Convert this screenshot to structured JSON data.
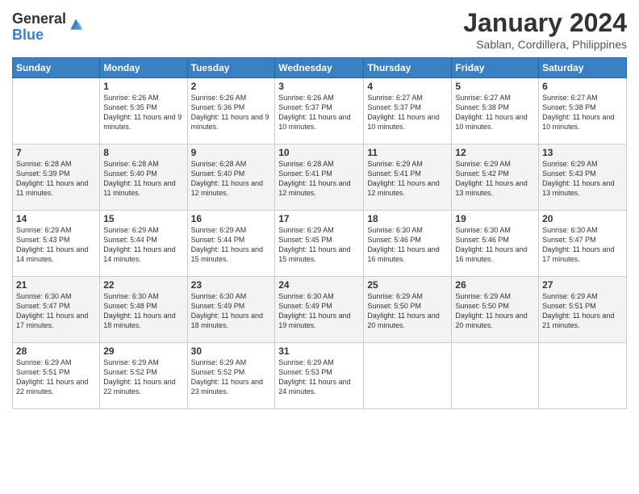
{
  "logo": {
    "general": "General",
    "blue": "Blue"
  },
  "title": "January 2024",
  "subtitle": "Sablan, Cordillera, Philippines",
  "weekdays": [
    "Sunday",
    "Monday",
    "Tuesday",
    "Wednesday",
    "Thursday",
    "Friday",
    "Saturday"
  ],
  "weeks": [
    [
      {
        "day": "",
        "sunrise": "",
        "sunset": "",
        "daylight": ""
      },
      {
        "day": "1",
        "sunrise": "Sunrise: 6:26 AM",
        "sunset": "Sunset: 5:35 PM",
        "daylight": "Daylight: 11 hours and 9 minutes."
      },
      {
        "day": "2",
        "sunrise": "Sunrise: 6:26 AM",
        "sunset": "Sunset: 5:36 PM",
        "daylight": "Daylight: 11 hours and 9 minutes."
      },
      {
        "day": "3",
        "sunrise": "Sunrise: 6:26 AM",
        "sunset": "Sunset: 5:37 PM",
        "daylight": "Daylight: 11 hours and 10 minutes."
      },
      {
        "day": "4",
        "sunrise": "Sunrise: 6:27 AM",
        "sunset": "Sunset: 5:37 PM",
        "daylight": "Daylight: 11 hours and 10 minutes."
      },
      {
        "day": "5",
        "sunrise": "Sunrise: 6:27 AM",
        "sunset": "Sunset: 5:38 PM",
        "daylight": "Daylight: 11 hours and 10 minutes."
      },
      {
        "day": "6",
        "sunrise": "Sunrise: 6:27 AM",
        "sunset": "Sunset: 5:38 PM",
        "daylight": "Daylight: 11 hours and 10 minutes."
      }
    ],
    [
      {
        "day": "7",
        "sunrise": "Sunrise: 6:28 AM",
        "sunset": "Sunset: 5:39 PM",
        "daylight": "Daylight: 11 hours and 11 minutes."
      },
      {
        "day": "8",
        "sunrise": "Sunrise: 6:28 AM",
        "sunset": "Sunset: 5:40 PM",
        "daylight": "Daylight: 11 hours and 11 minutes."
      },
      {
        "day": "9",
        "sunrise": "Sunrise: 6:28 AM",
        "sunset": "Sunset: 5:40 PM",
        "daylight": "Daylight: 11 hours and 12 minutes."
      },
      {
        "day": "10",
        "sunrise": "Sunrise: 6:28 AM",
        "sunset": "Sunset: 5:41 PM",
        "daylight": "Daylight: 11 hours and 12 minutes."
      },
      {
        "day": "11",
        "sunrise": "Sunrise: 6:29 AM",
        "sunset": "Sunset: 5:41 PM",
        "daylight": "Daylight: 11 hours and 12 minutes."
      },
      {
        "day": "12",
        "sunrise": "Sunrise: 6:29 AM",
        "sunset": "Sunset: 5:42 PM",
        "daylight": "Daylight: 11 hours and 13 minutes."
      },
      {
        "day": "13",
        "sunrise": "Sunrise: 6:29 AM",
        "sunset": "Sunset: 5:43 PM",
        "daylight": "Daylight: 11 hours and 13 minutes."
      }
    ],
    [
      {
        "day": "14",
        "sunrise": "Sunrise: 6:29 AM",
        "sunset": "Sunset: 5:43 PM",
        "daylight": "Daylight: 11 hours and 14 minutes."
      },
      {
        "day": "15",
        "sunrise": "Sunrise: 6:29 AM",
        "sunset": "Sunset: 5:44 PM",
        "daylight": "Daylight: 11 hours and 14 minutes."
      },
      {
        "day": "16",
        "sunrise": "Sunrise: 6:29 AM",
        "sunset": "Sunset: 5:44 PM",
        "daylight": "Daylight: 11 hours and 15 minutes."
      },
      {
        "day": "17",
        "sunrise": "Sunrise: 6:29 AM",
        "sunset": "Sunset: 5:45 PM",
        "daylight": "Daylight: 11 hours and 15 minutes."
      },
      {
        "day": "18",
        "sunrise": "Sunrise: 6:30 AM",
        "sunset": "Sunset: 5:46 PM",
        "daylight": "Daylight: 11 hours and 16 minutes."
      },
      {
        "day": "19",
        "sunrise": "Sunrise: 6:30 AM",
        "sunset": "Sunset: 5:46 PM",
        "daylight": "Daylight: 11 hours and 16 minutes."
      },
      {
        "day": "20",
        "sunrise": "Sunrise: 6:30 AM",
        "sunset": "Sunset: 5:47 PM",
        "daylight": "Daylight: 11 hours and 17 minutes."
      }
    ],
    [
      {
        "day": "21",
        "sunrise": "Sunrise: 6:30 AM",
        "sunset": "Sunset: 5:47 PM",
        "daylight": "Daylight: 11 hours and 17 minutes."
      },
      {
        "day": "22",
        "sunrise": "Sunrise: 6:30 AM",
        "sunset": "Sunset: 5:48 PM",
        "daylight": "Daylight: 11 hours and 18 minutes."
      },
      {
        "day": "23",
        "sunrise": "Sunrise: 6:30 AM",
        "sunset": "Sunset: 5:49 PM",
        "daylight": "Daylight: 11 hours and 18 minutes."
      },
      {
        "day": "24",
        "sunrise": "Sunrise: 6:30 AM",
        "sunset": "Sunset: 5:49 PM",
        "daylight": "Daylight: 11 hours and 19 minutes."
      },
      {
        "day": "25",
        "sunrise": "Sunrise: 6:29 AM",
        "sunset": "Sunset: 5:50 PM",
        "daylight": "Daylight: 11 hours and 20 minutes."
      },
      {
        "day": "26",
        "sunrise": "Sunrise: 6:29 AM",
        "sunset": "Sunset: 5:50 PM",
        "daylight": "Daylight: 11 hours and 20 minutes."
      },
      {
        "day": "27",
        "sunrise": "Sunrise: 6:29 AM",
        "sunset": "Sunset: 5:51 PM",
        "daylight": "Daylight: 11 hours and 21 minutes."
      }
    ],
    [
      {
        "day": "28",
        "sunrise": "Sunrise: 6:29 AM",
        "sunset": "Sunset: 5:51 PM",
        "daylight": "Daylight: 11 hours and 22 minutes."
      },
      {
        "day": "29",
        "sunrise": "Sunrise: 6:29 AM",
        "sunset": "Sunset: 5:52 PM",
        "daylight": "Daylight: 11 hours and 22 minutes."
      },
      {
        "day": "30",
        "sunrise": "Sunrise: 6:29 AM",
        "sunset": "Sunset: 5:52 PM",
        "daylight": "Daylight: 11 hours and 23 minutes."
      },
      {
        "day": "31",
        "sunrise": "Sunrise: 6:29 AM",
        "sunset": "Sunset: 5:53 PM",
        "daylight": "Daylight: 11 hours and 24 minutes."
      },
      {
        "day": "",
        "sunrise": "",
        "sunset": "",
        "daylight": ""
      },
      {
        "day": "",
        "sunrise": "",
        "sunset": "",
        "daylight": ""
      },
      {
        "day": "",
        "sunrise": "",
        "sunset": "",
        "daylight": ""
      }
    ]
  ]
}
